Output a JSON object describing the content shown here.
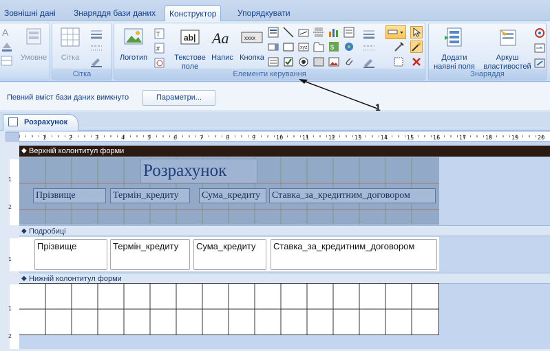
{
  "tabs": [
    {
      "label": "Зовнішні дані"
    },
    {
      "label": "Знаряддя бази даних"
    },
    {
      "label": "Конструктор",
      "active": true
    },
    {
      "label": "Упорядкувати"
    }
  ],
  "ribbon": {
    "partial_left": {
      "label": "Умовне"
    },
    "grid_group": {
      "label": "Сітка",
      "button_label": "Сітка"
    },
    "controls_group": {
      "label": "Елементи керування",
      "logo_label": "Логотип",
      "textbox_label": "Текстове поле",
      "label_label": "Напис",
      "button_label": "Кнопка",
      "label_icon_text": "Aa",
      "textbox_icon_text": "ab|",
      "button_icon_text": "xxxx"
    },
    "tools_group": {
      "label": "Знаряддя",
      "add_fields_label": "Додати наявні поля",
      "property_sheet_label": "Аркуш властивостей"
    }
  },
  "message_bar": {
    "text": "Певний вміст бази даних вимкнуто",
    "button_label": "Параметри..."
  },
  "document": {
    "tab_label": "Розрахунок"
  },
  "form": {
    "header_section": "Верхній колонтитул форми",
    "title": "Розрахунок",
    "header_labels": [
      "Прізвище",
      "Термін_кредиту",
      "Сума_кредиту",
      "Ставка_за_кредитним_договором"
    ],
    "detail_section": "Подробиці",
    "detail_fields": [
      "Прізвище",
      "Термін_кредиту",
      "Сума_кредиту",
      "Ставка_за_кредитним_договором"
    ],
    "footer_section": "Нижній колонтитул форми"
  },
  "ruler": {
    "h_numbers": [
      "1",
      "2",
      "3",
      "4",
      "5",
      "6",
      "7",
      "8",
      "9",
      "10",
      "11",
      "12",
      "13",
      "14",
      "15",
      "16",
      "17",
      "18",
      "19",
      "20"
    ],
    "v_header": [
      "1",
      "2"
    ],
    "v_detail": [
      "1"
    ],
    "v_footer": [
      "1",
      "2"
    ]
  },
  "annotation": {
    "callout_number": "1"
  },
  "colors": {
    "header_bar": "#2b1a12",
    "header_bg": "#93a9c8",
    "ribbon_text": "#15428b"
  }
}
